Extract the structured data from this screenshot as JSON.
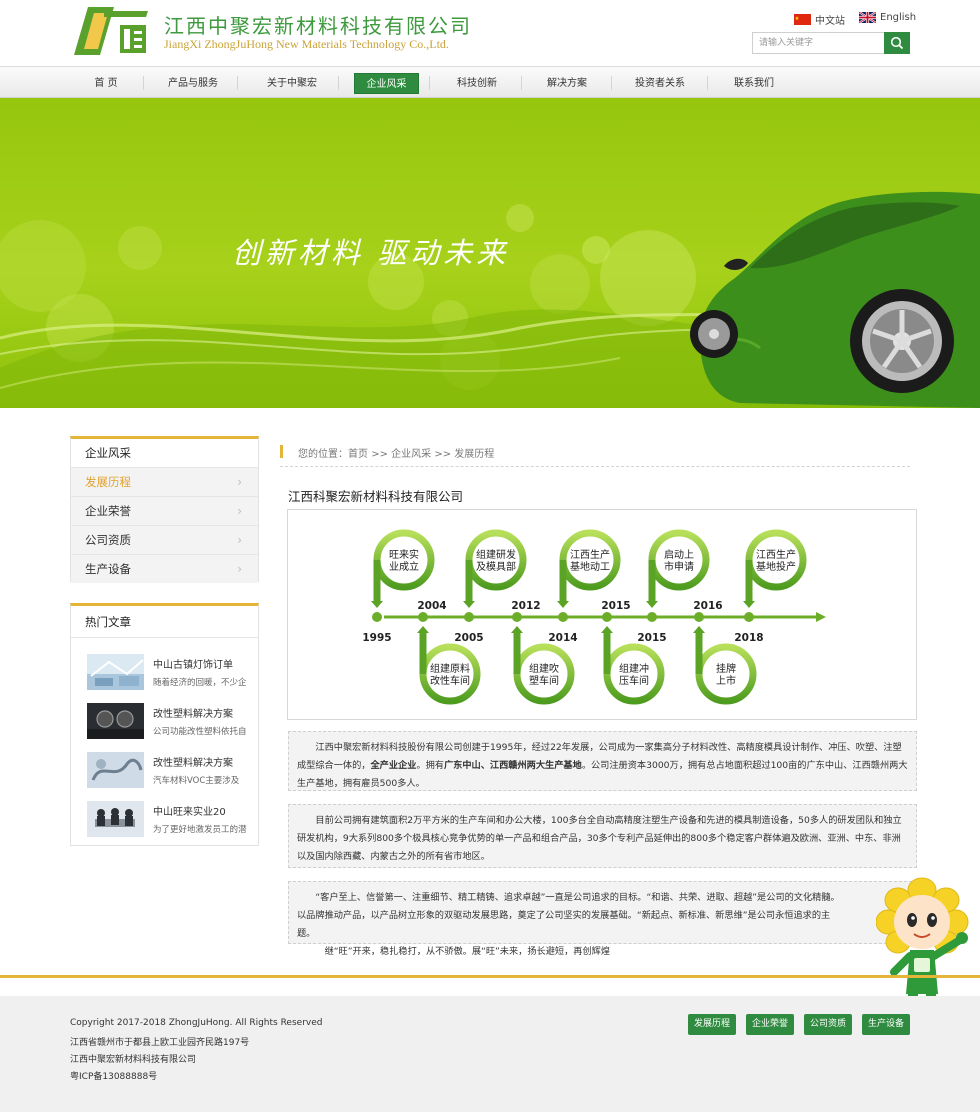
{
  "header": {
    "company_cn": "江西中聚宏新材料科技有限公司",
    "company_en": "JiangXi ZhongJuHong New Materials Technology Co.,Ltd.",
    "lang_cn": "中文站",
    "lang_en": "English",
    "search_placeholder": "请输入关键字"
  },
  "nav": {
    "items": [
      "首 页",
      "产品与服务",
      "关于中聚宏",
      "企业风采",
      "科技创新",
      "解决方案",
      "投资者关系",
      "联系我们"
    ],
    "active": "企业风采"
  },
  "banner": {
    "slogan": "创新材料  驱动未来"
  },
  "sidebar": {
    "title": "企业风采",
    "items": [
      "发展历程",
      "企业荣誉",
      "公司资质",
      "生产设备"
    ],
    "active": "发展历程",
    "hot_title": "热门文章",
    "hot": [
      {
        "title": "中山古镇灯饰订单",
        "desc": "随着经济的回暖，不少企"
      },
      {
        "title": "改性塑料解决方案",
        "desc": "公司功能改性塑料依托自"
      },
      {
        "title": "改性塑料解决方案",
        "desc": "汽车材料VOC主要涉及"
      },
      {
        "title": "中山旺来实业20",
        "desc": "为了更好地激发员工的潜"
      }
    ]
  },
  "breadcrumb": {
    "prefix": "您的位置：",
    "home": "首页",
    "sep": ">>",
    "section": "企业风采",
    "current": "发展历程"
  },
  "content": {
    "title": "江西科聚宏新材料科技有限公司",
    "timeline_top": [
      {
        "year": "1995",
        "label": "旺来实\n业成立"
      },
      {
        "year": "2005",
        "label": "组建研发\n及模具部"
      },
      {
        "year": "2014",
        "label": "江西生产\n基地动工"
      },
      {
        "year": "2015",
        "label": "启动上\n市申请"
      },
      {
        "year": "2018",
        "label": "江西生产\n基地投产"
      }
    ],
    "timeline_bottom": [
      {
        "year": "2004",
        "label": "组建原料\n改性车间"
      },
      {
        "year": "2012",
        "label": "组建吹\n塑车间"
      },
      {
        "year": "2015",
        "label": "组建冲\n压车间"
      },
      {
        "year": "2016",
        "label": "挂牌\n上市"
      }
    ],
    "para1_plain1": "江西中聚宏新材料科技股份有限公司创建于1995年，经过22年发展，公司成为一家集高分子材料改性、高精度模具设计制作、冲压、吹塑、注塑成型综合一体的，",
    "para1_bold1": "全产业企业",
    "para1_plain2": "。拥有",
    "para1_bold2": "广东中山、江西赣州两大生产基地",
    "para1_plain3": "。公司注册资本3000万，拥有总占地面积超过100亩的广东中山、江西赣州两大生产基地，拥有雇员500多人。",
    "para2": "目前公司拥有建筑面积2万平方米的生产车间和办公大楼，100多台全自动高精度注塑生产设备和先进的模具制造设备，50多人的研发团队和独立研发机构，9大系列800多个极具核心竞争优势的单一产品和组合产品，30多个专利产品延伸出的800多个稳定客户群体遍及欧洲、亚洲、中东、非洲以及国内除西藏、内蒙古之外的所有省市地区。",
    "para3": "“客户至上、信誉第一、注重细节、精工精铸、追求卓越”一直是公司追求的目标。“和谐、共荣、进取、超越”是公司的文化精髓。以品牌推动产品，以产品树立形象的双驱动发展思路，奠定了公司坚实的发展基础。“新起点、新标准、新思维”是公司永恒追求的主题。",
    "para3_line2": "继“旺”开来，稳扎稳打，从不骄傲。展“旺”未来，扬长避短，再创辉煌"
  },
  "footer": {
    "copyright": "Copyright 2017-2018 ZhongJuHong. All Rights Reserved",
    "address": "江西省赣州市于都县上欧工业园齐民路197号",
    "company": "江西中聚宏新材料科技有限公司",
    "icp": "粤ICP备13088888号",
    "buttons": [
      "发展历程",
      "企业荣誉",
      "公司资质",
      "生产设备"
    ]
  },
  "colors": {
    "brand_green": "#2e8b3f",
    "accent_gold": "#e5b539",
    "banner_green": "#a7d11a"
  }
}
